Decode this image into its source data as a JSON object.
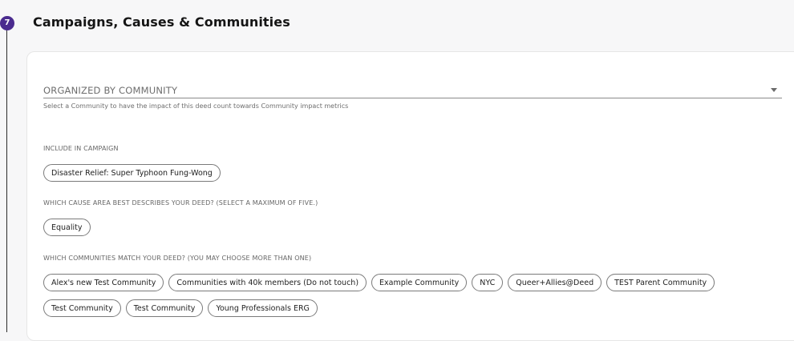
{
  "step": {
    "number": "7",
    "title": "Campaigns, Causes & Communities"
  },
  "community_select": {
    "label": "ORGANIZED BY COMMUNITY",
    "helper": "Select a Community to have the impact of this deed count towards Community impact metrics"
  },
  "campaign": {
    "label": "INCLUDE IN CAMPAIGN",
    "chips": [
      "Disaster Relief: Super Typhoon Fung-Wong"
    ]
  },
  "causes": {
    "label": "WHICH CAUSE AREA BEST DESCRIBES YOUR DEED? (SELECT A MAXIMUM OF FIVE.)",
    "chips": [
      "Equality"
    ]
  },
  "communities": {
    "label": "WHICH COMMUNITIES MATCH YOUR DEED? (YOU MAY CHOOSE MORE THAN ONE)",
    "chips": [
      "Alex's new Test Community",
      "Communities with 40k members (Do not touch)",
      "Example Community",
      "NYC",
      "Queer+Allies@Deed",
      "TEST Parent Community",
      "Test Community",
      "Test Community",
      "Young Professionals ERG"
    ]
  },
  "colors": {
    "badge": "#4b2c8f",
    "chip_border": "#7a7a7a"
  }
}
